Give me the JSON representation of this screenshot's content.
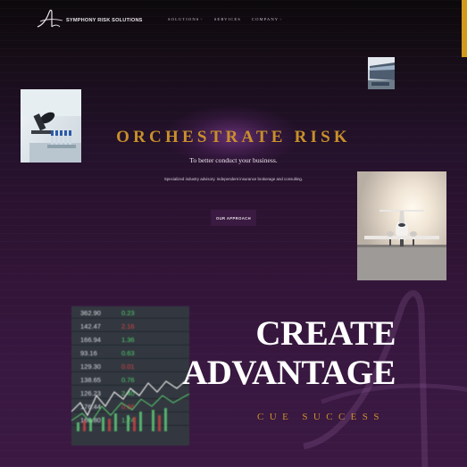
{
  "header": {
    "brand": "SYMPHONY RISK SOLUTIONS",
    "logo_icon": "symphony-logo-icon",
    "nav": [
      {
        "label": "SOLUTIONS",
        "has_dropdown": true
      },
      {
        "label": "SERVICES",
        "has_dropdown": false
      },
      {
        "label": "COMPANY",
        "has_dropdown": true
      }
    ]
  },
  "hero": {
    "title": "ORCHESTRATE RISK",
    "subtitle": "To better conduct your business.",
    "description": "Specialized industry advisory. Independent insurance brokerage and consulting.",
    "cta_label": "OUR APPROACH"
  },
  "section": {
    "heading_line1": "CREATE",
    "heading_line2": "ADVANTAGE",
    "tagline": "CUE SUCCESS"
  },
  "images": {
    "microscope": "microscope-photo",
    "building": "building-photo",
    "jet": "private-jet-photo",
    "stocks": "stock-ticker-photo"
  },
  "stocks_numbers": [
    "362.90",
    "142.47",
    "166.94",
    "93.16",
    "129.30",
    "138.65",
    "126.23",
    "176.44",
    "168.80"
  ],
  "colors": {
    "accent_gold": "#c9902a",
    "gold_bar": "#d29a1c",
    "button_bg": "#3a1a40",
    "bg_dark": "#0c090c",
    "bg_purple": "#3a1842"
  }
}
